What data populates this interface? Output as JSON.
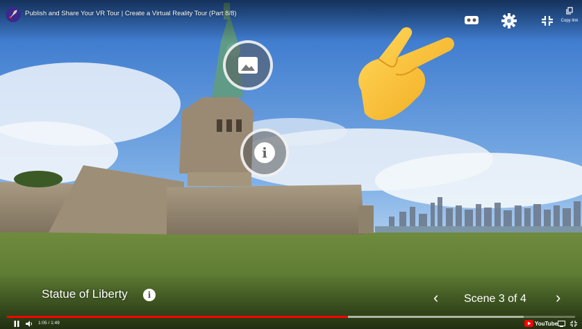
{
  "player": {
    "video_title": "Publish and Share Your VR Tour | Create a Virtual Reality Tour (Part 8/8)",
    "copy_link_label": "Copy link",
    "time_current": "1:05",
    "time_separator": "/",
    "time_total": "1:49",
    "progress_played_fraction": 0.6,
    "progress_loaded_fraction": 0.91,
    "youtube_label": "YouTube",
    "progress_color": "#ff0000"
  },
  "tour": {
    "scene_title": "Statue of Liberty",
    "scene_counter": "Scene 3 of 4",
    "prev_arrow": "‹",
    "next_arrow": "›",
    "hotspots": [
      {
        "name": "image-hotspot",
        "icon": "image-icon"
      },
      {
        "name": "info-hotspot",
        "icon": "info-icon",
        "glyph": "i"
      }
    ]
  },
  "icons": {
    "channel": "rocket-icon",
    "vr": "vr-headset-icon",
    "settings": "gear-icon",
    "exit_fullscreen": "exit-fullscreen-icon",
    "copy": "copy-icon",
    "play_state": "pause-icon",
    "volume": "volume-icon",
    "captions": "captions-icon",
    "fullscreen": "fullscreen-icon",
    "pointer": "pointing-hand-icon"
  }
}
